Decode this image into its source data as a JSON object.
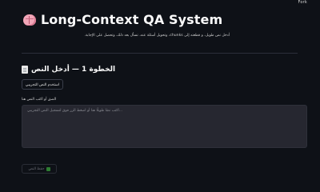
{
  "top_menu": {
    "label": "Fork"
  },
  "header": {
    "icon": "brain-icon",
    "title": "Long-Context QA System",
    "subtitle": "أدخل نص طويل، و قطعته إلى chunks، وتحويل أسئلة عنه، تسأل بعد ذلك، وتحصل على الإجابة."
  },
  "step": {
    "icon": "document-icon",
    "title": "الخطوة 1 — أدخل النص"
  },
  "sample_button": {
    "label": "استخدم النص التجريبي"
  },
  "text_input": {
    "label": "الصق أو اكتب النص هنا",
    "placeholder": "...اكتب نصًا طويلًا هنا أو اضغط الزر فوق لتسجيل النص التجريبي",
    "value": ""
  },
  "save_button": {
    "label": "حفظ النص",
    "icon": "check-icon"
  },
  "colors": {
    "background": "#0e1117",
    "input_background": "#262730",
    "text": "#fafafa"
  }
}
